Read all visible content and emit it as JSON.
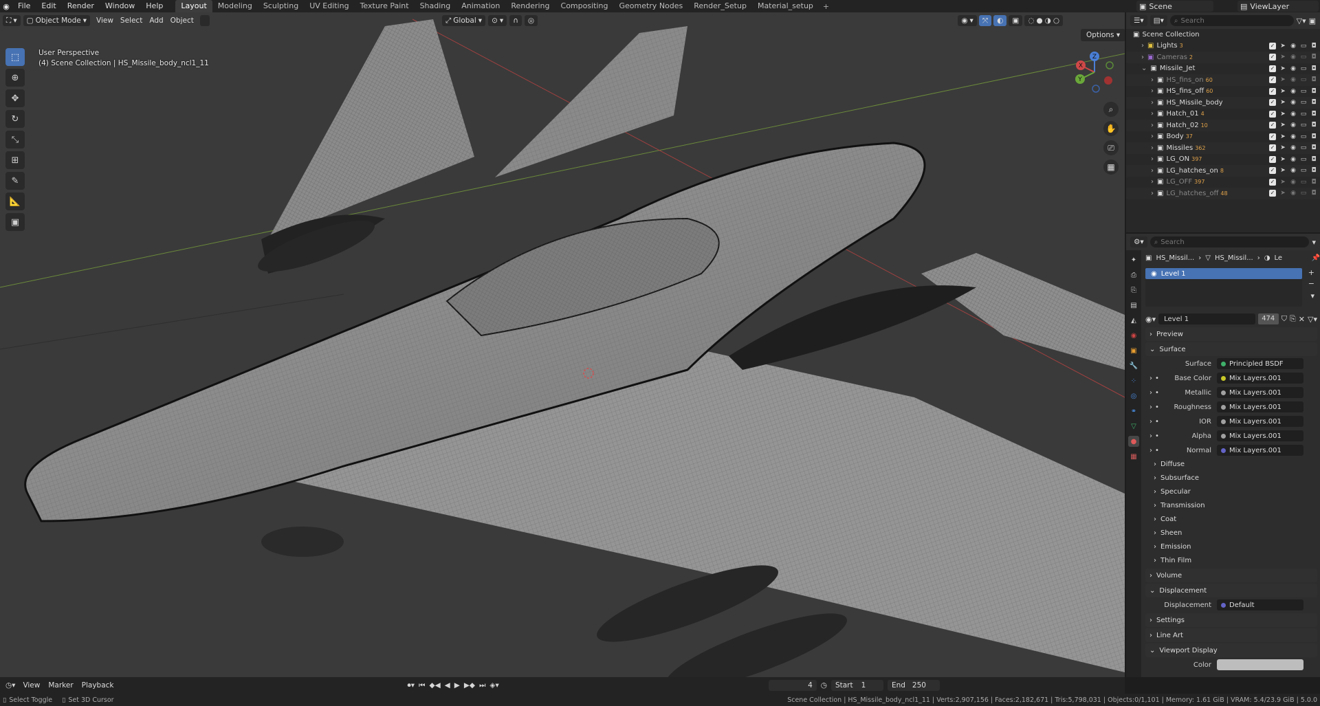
{
  "menu": {
    "items": [
      "File",
      "Edit",
      "Render",
      "Window",
      "Help"
    ],
    "workspaces": [
      "Layout",
      "Modeling",
      "Sculpting",
      "UV Editing",
      "Texture Paint",
      "Shading",
      "Animation",
      "Rendering",
      "Compositing",
      "Geometry Nodes",
      "Render_Setup",
      "Material_setup"
    ],
    "active_workspace": "Layout",
    "add_symbol": "+",
    "scene": "Scene",
    "view_layer": "ViewLayer"
  },
  "viewport": {
    "mode": "Object Mode",
    "menus": [
      "View",
      "Select",
      "Add",
      "Object"
    ],
    "orientation": "Global",
    "options": "Options",
    "info_line1": "User Perspective",
    "info_line2": "(4) Scene Collection | HS_Missile_body_ncl1_11",
    "gizmo_x": "X",
    "gizmo_y": "Y",
    "gizmo_z": "Z"
  },
  "outliner": {
    "search_placeholder": "Search",
    "root": "Scene Collection",
    "rows": [
      {
        "name": "Lights",
        "badge": "3",
        "dim": false
      },
      {
        "name": "Cameras",
        "badge": "2",
        "dim": true
      },
      {
        "name": "Missile_Jet",
        "badge": "",
        "dim": false
      },
      {
        "name": "HS_fins_on",
        "badge": "60",
        "dim": true
      },
      {
        "name": "HS_fins_off",
        "badge": "60",
        "dim": false
      },
      {
        "name": "HS_Missile_body",
        "badge": "",
        "dim": false
      },
      {
        "name": "Hatch_01",
        "badge": "4",
        "dim": false
      },
      {
        "name": "Hatch_02",
        "badge": "10",
        "dim": false
      },
      {
        "name": "Body",
        "badge": "37",
        "dim": false
      },
      {
        "name": "Missiles",
        "badge": "362",
        "dim": false
      },
      {
        "name": "LG_ON",
        "badge": "397",
        "dim": false
      },
      {
        "name": "LG_hatches_on",
        "badge": "8",
        "dim": false
      },
      {
        "name": "LG_OFF",
        "badge": "397",
        "dim": true
      },
      {
        "name": "LG_hatches_off",
        "badge": "48",
        "dim": true
      }
    ]
  },
  "properties": {
    "search_placeholder": "Search",
    "crumb1": "HS_Missil...",
    "crumb2": "HS_Missil...",
    "crumb3": "Le",
    "slot": "Level 1",
    "material_name": "Level 1",
    "material_users": "474",
    "preview": "Preview",
    "surface_panel": "Surface",
    "surface_label": "Surface",
    "surface_value": "Principled BSDF",
    "inputs": [
      {
        "label": "Base Color",
        "value": "Mix Layers.001",
        "color": "#c7c729"
      },
      {
        "label": "Metallic",
        "value": "Mix Layers.001",
        "color": "#a1a1a1"
      },
      {
        "label": "Roughness",
        "value": "Mix Layers.001",
        "color": "#a1a1a1"
      },
      {
        "label": "IOR",
        "value": "Mix Layers.001",
        "color": "#a1a1a1"
      },
      {
        "label": "Alpha",
        "value": "Mix Layers.001",
        "color": "#a1a1a1"
      },
      {
        "label": "Normal",
        "value": "Mix Layers.001",
        "color": "#6363c7"
      }
    ],
    "subpanels": [
      "Diffuse",
      "Subsurface",
      "Specular",
      "Transmission",
      "Coat",
      "Sheen",
      "Emission",
      "Thin Film"
    ],
    "volume": "Volume",
    "displacement_panel": "Displacement",
    "displacement_label": "Displacement",
    "displacement_value": "Default",
    "settings": "Settings",
    "line_art": "Line Art",
    "viewport_display": "Viewport Display",
    "color_label": "Color"
  },
  "timeline": {
    "menus": [
      "View",
      "Marker",
      "Playback"
    ],
    "current_frame": "4",
    "start_label": "Start",
    "start": "1",
    "end_label": "End",
    "end": "250"
  },
  "status": {
    "left1": "Select Toggle",
    "left2": "Set 3D Cursor",
    "right": "Scene Collection | HS_Missile_body_ncl1_11 | Verts:2,907,156 | Faces:2,182,671 | Tris:5,798,031 | Objects:0/1,101 | Memory: 1.61 GiB | VRAM: 5.4/23.9 GiB | 5.0.0"
  },
  "colors": {
    "accent": "#4772b3",
    "viewport_bg": "#3a3a3a",
    "panel_bg": "#2d2d2d"
  }
}
